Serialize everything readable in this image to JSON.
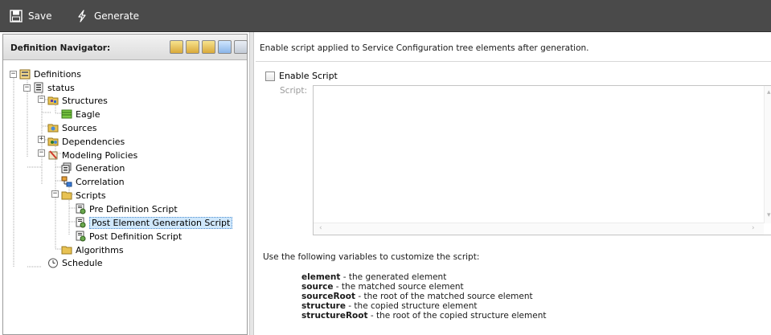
{
  "toolbar": {
    "save_label": "Save",
    "generate_label": "Generate"
  },
  "navigator": {
    "title": "Definition Navigator:",
    "tools": [
      "notes-icon",
      "tree-expand-icon",
      "tree-collapse-icon",
      "refresh-icon",
      "close-icon"
    ],
    "tree": {
      "definitions": "Definitions",
      "status": "status",
      "structures": "Structures",
      "eagle": "Eagle",
      "sources": "Sources",
      "dependencies": "Dependencies",
      "modeling_policies": "Modeling Policies",
      "generation": "Generation",
      "correlation": "Correlation",
      "scripts": "Scripts",
      "pre_definition_script": "Pre Definition Script",
      "post_element_generation_script": "Post Element Generation Script",
      "post_definition_script": "Post Definition Script",
      "algorithms": "Algorithms",
      "schedule": "Schedule"
    },
    "selected": "Post Element Generation Script"
  },
  "content": {
    "description": "Enable script applied to Service Configuration tree elements after generation.",
    "enable_label": "Enable Script",
    "enable_checked": false,
    "script_label": "Script:",
    "script_value": "",
    "vars_intro": "Use the following variables to customize the script:",
    "variables": [
      {
        "name": "element",
        "desc": " - the generated element"
      },
      {
        "name": "source",
        "desc": " - the matched source element"
      },
      {
        "name": "sourceRoot",
        "desc": " - the root of the matched source element"
      },
      {
        "name": "structure",
        "desc": " - the copied structure element"
      },
      {
        "name": "structureRoot",
        "desc": " - the root of the copied structure element"
      }
    ]
  },
  "colors": {
    "toolbar_bg": "#4a4a4a",
    "selection_bg": "#cfe7fb",
    "folder": "#e8c253"
  }
}
